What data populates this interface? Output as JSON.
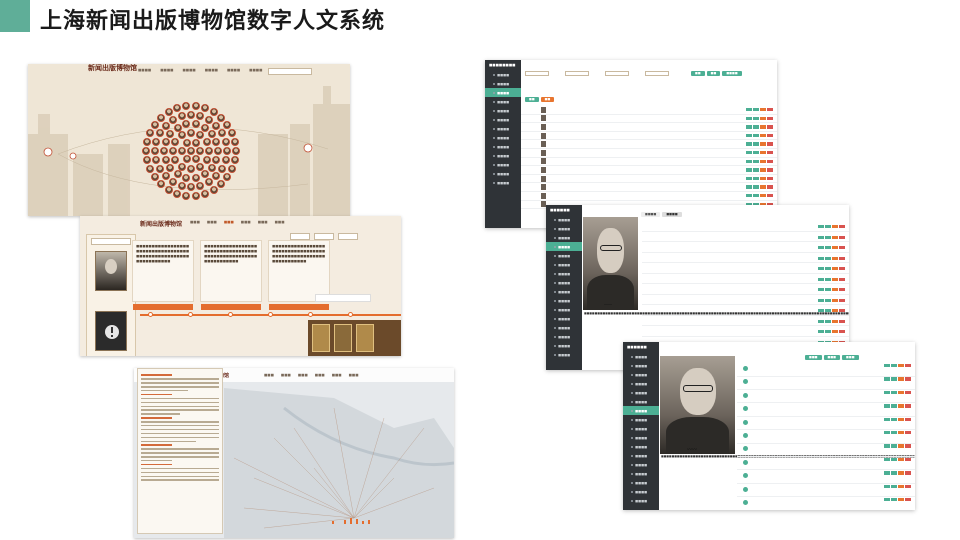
{
  "slide": {
    "title": "上海新闻出版博物馆数字人文系统",
    "accent_color": "#5fae98"
  },
  "frontend": {
    "logo_text": "新闻出版博物馆",
    "map_search_placeholder": "",
    "portrait_captions": [
      "",
      "",
      ""
    ]
  },
  "admin": {
    "accent_green": "#4caf94",
    "accent_orange": "#e8752f",
    "sidebar_bg": "#2f3337"
  }
}
